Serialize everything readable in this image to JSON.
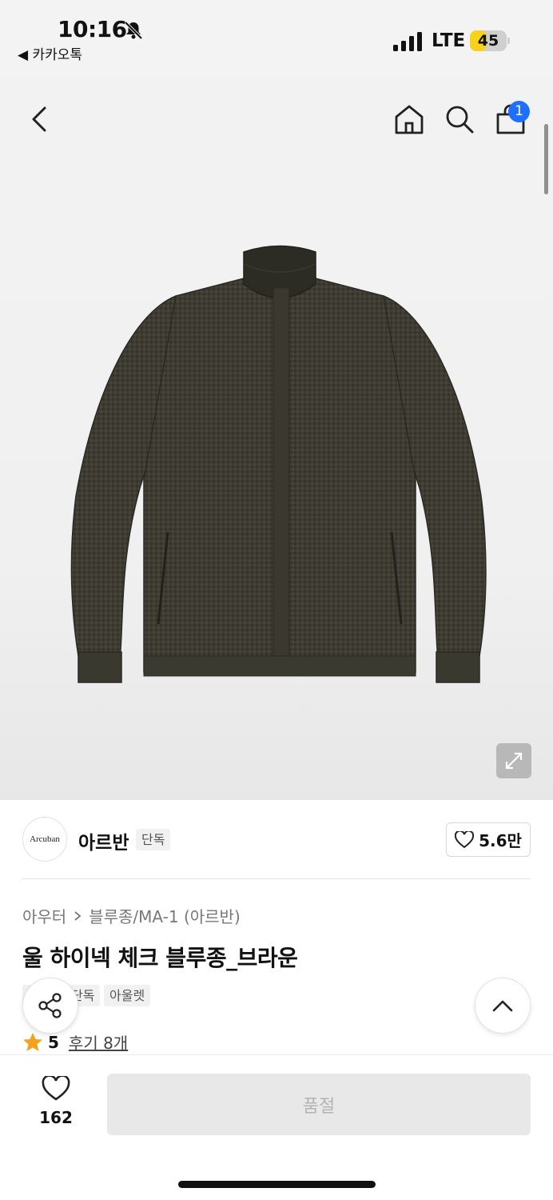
{
  "status_bar": {
    "time": "10:16",
    "back_app": "◀ 카카오톡",
    "network": "LTE",
    "battery": "45",
    "battery_level": 0.45,
    "battery_color": "#f7d21c"
  },
  "nav": {
    "cart_count": "1",
    "badge_color": "#1f6fff"
  },
  "brand": {
    "logo_text": "Arcuban",
    "name": "아르반",
    "tag": "단독",
    "likes": "5.6만"
  },
  "product": {
    "category": "아우터",
    "subcategory": "블루종/MA-1 (아르반)",
    "title": "울 하이넥 체크 블루종_브라운",
    "tags": [
      "단독",
      "단독",
      "아울렛"
    ],
    "rating": "5",
    "reviews": "후기 8개"
  },
  "bottom_bar": {
    "wish_count": "162",
    "action_label": "품절"
  }
}
